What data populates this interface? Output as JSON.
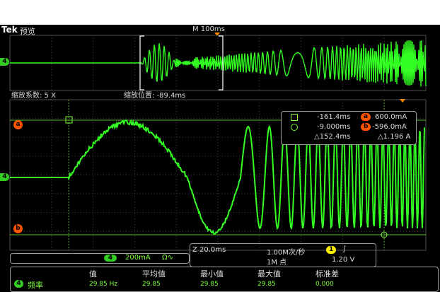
{
  "header": {
    "brand": "Tek",
    "mode": "预览",
    "timebase": "M 100ms"
  },
  "overview": {
    "channel": "4"
  },
  "zoom": {
    "factor_label": "缩放系数: 5 X",
    "position_label": "缩放位置: -89.4ms"
  },
  "markers": {
    "a": "a",
    "b": "b",
    "ch4": "4"
  },
  "cursor": {
    "t1": "-161.4ms",
    "a_val": "600.0mA",
    "t2": "-9.000ms",
    "b_val": "-596.0mA",
    "dt": "△152.4ms",
    "dv": "△1.196 A",
    "a_label": "a",
    "b_label": "b"
  },
  "channel_box": {
    "ch": "4",
    "scale": "200mA",
    "coupling": "Ω∿"
  },
  "acq": {
    "zoom_scale": "Z 20.0ms",
    "rate": "1.00M次/秒",
    "points": "1M 点",
    "trig_ch": "1",
    "trig_level": "1.20 V",
    "trig_slope": "∫"
  },
  "measure": {
    "headers": [
      "值",
      "平均值",
      "最小值",
      "最大值",
      "标准差"
    ],
    "ch": "4",
    "name": "频率",
    "values": [
      "29.85 Hz",
      "29.85",
      "29.85",
      "29.85",
      "0.000"
    ]
  },
  "colors": {
    "trace": "#33ff22",
    "accent": "#ff8800",
    "marker": "#ff5500"
  }
}
